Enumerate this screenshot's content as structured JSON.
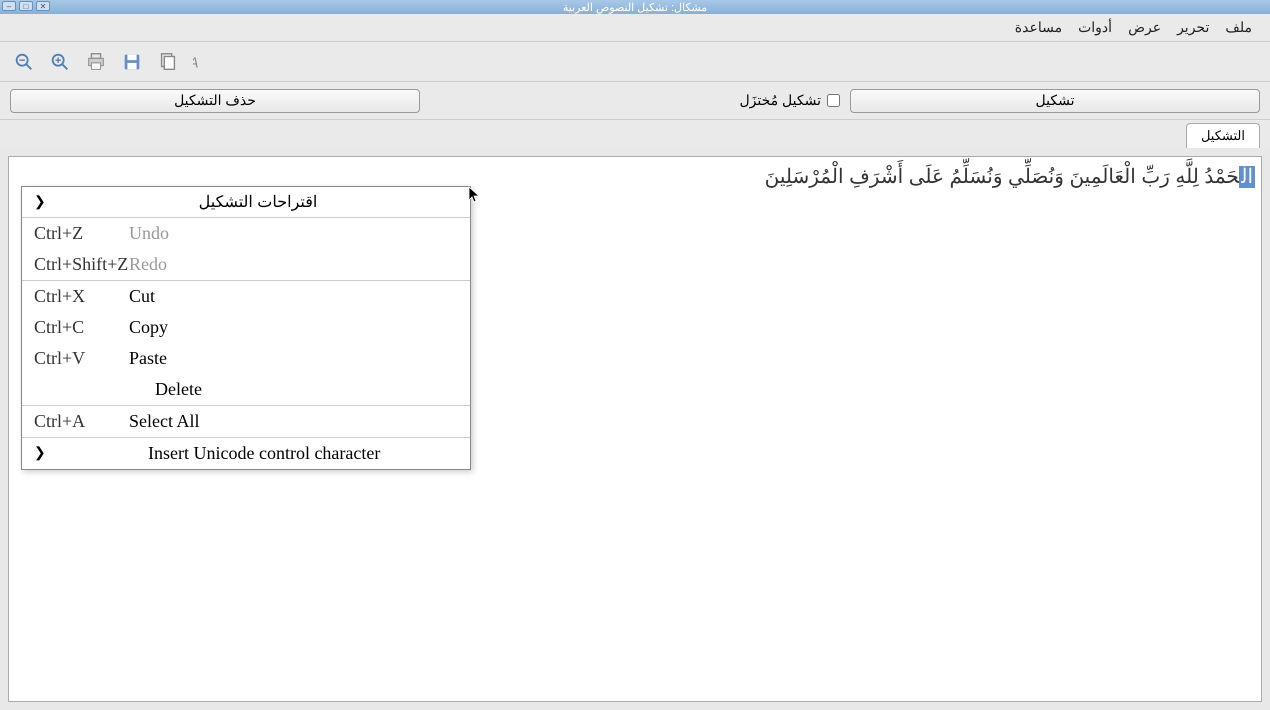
{
  "window": {
    "title": "مشكال: تشكيل النصوص العربية"
  },
  "menubar": {
    "file": "ملف",
    "edit": "تحرير",
    "view": "عرض",
    "tools": "أدوات",
    "help": "مساعدة"
  },
  "buttons": {
    "tashkeel": "تشكيل",
    "reduced_tashkeel": "تشكيل مُختزَل",
    "delete_tashkeel": "حذف التشكيل"
  },
  "tabs": {
    "tashkeel": "التشكيل"
  },
  "text_content": {
    "selected": "الْ",
    "rest": "حَمْدُ لِلَّهِ رَبِّ الْعَالَمِينَ وَنُصَلِّي وَنُسَلِّمُ عَلَى أَشْرَفِ الْمُرْسَلِينَ"
  },
  "context_menu": {
    "tashkeel_suggestions": "اقتراحات التشكيل",
    "undo": {
      "label": "Undo",
      "shortcut": "Ctrl+Z"
    },
    "redo": {
      "label": "Redo",
      "shortcut": "Ctrl+Shift+Z"
    },
    "cut": {
      "label": "Cut",
      "shortcut": "Ctrl+X"
    },
    "copy": {
      "label": "Copy",
      "shortcut": "Ctrl+C"
    },
    "paste": {
      "label": "Paste",
      "shortcut": "Ctrl+V"
    },
    "delete": {
      "label": "Delete"
    },
    "select_all": {
      "label": "Select All",
      "shortcut": "Ctrl+A"
    },
    "insert_unicode": {
      "label": "Insert Unicode control character"
    }
  }
}
